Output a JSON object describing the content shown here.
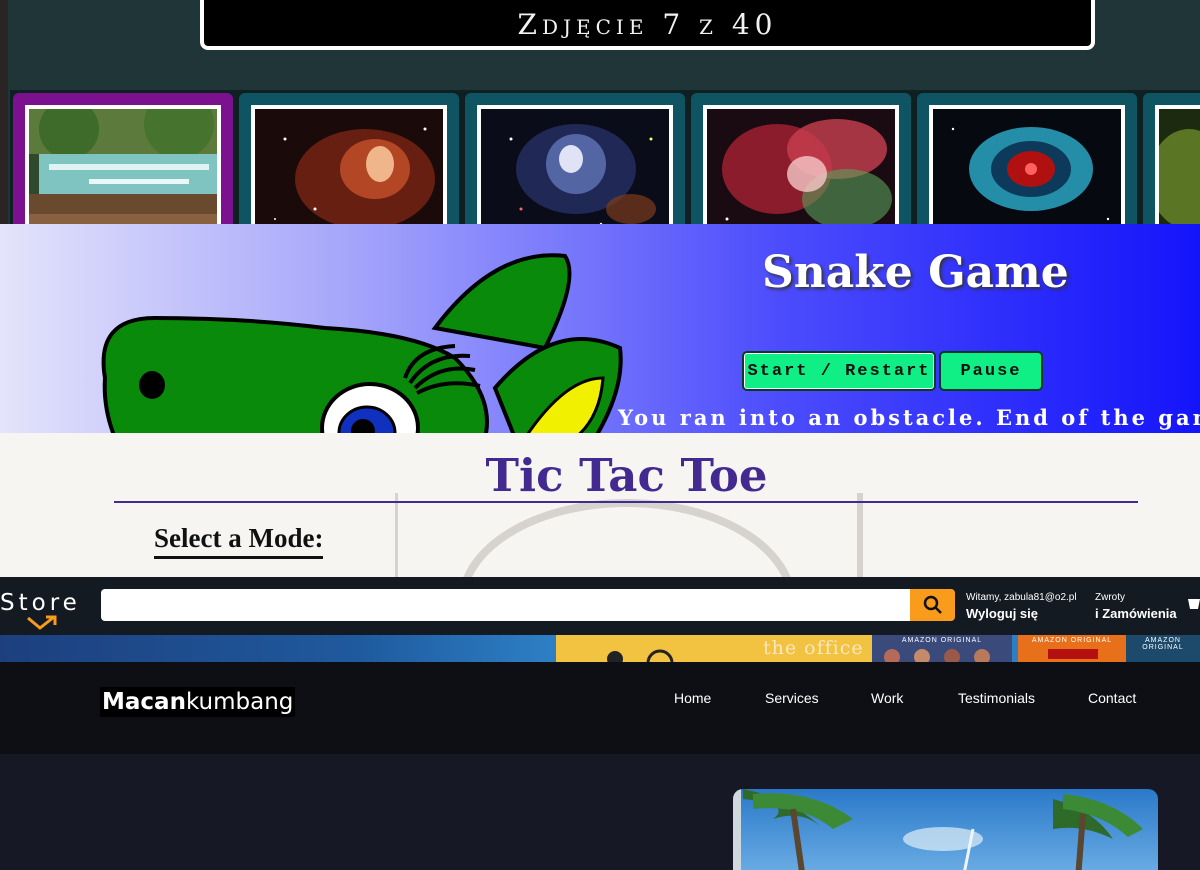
{
  "gallery": {
    "caption": "Zdjęcie 7 z 40",
    "thumbnails": [
      {
        "name": "waterfall-forest",
        "active": true
      },
      {
        "name": "red-nebula",
        "active": false
      },
      {
        "name": "star-cluster",
        "active": false
      },
      {
        "name": "pink-nebula",
        "active": false
      },
      {
        "name": "helix-nebula",
        "active": false
      },
      {
        "name": "green-partial",
        "active": false
      }
    ],
    "colors": {
      "active_frame": "#7b118e",
      "frame": "#0f5463"
    }
  },
  "snake": {
    "title": "Snake Game",
    "start_label": "Start / Restart",
    "pause_label": "Pause",
    "message": "You ran into an obstacle. End of the game",
    "colors": {
      "button": "#0fef85",
      "gradient_end": "#1414fb"
    }
  },
  "tictactoe": {
    "title": "Tic Tac Toe",
    "mode_label": "Select a Mode:",
    "colors": {
      "title": "#432a91"
    }
  },
  "store": {
    "logo": "Store",
    "search_value": "",
    "greeting": "Witamy, zabula81@o2.pl",
    "logout": "Wyloguj się",
    "returns": "Zwroty",
    "orders": "i Zamówienia",
    "colors": {
      "search_button": "#f99c1c",
      "header": "#131a22"
    }
  },
  "promo": {
    "office_title": "the office",
    "tiles": [
      "AMAZON ORIGINAL",
      "AMAZON ORIGINAL",
      "AMAZON ORIGINAL"
    ]
  },
  "site": {
    "brand_bold": "Macan",
    "brand_light": "kumbang",
    "nav": [
      "Home",
      "Services",
      "Work",
      "Testimonials",
      "Contact"
    ]
  }
}
